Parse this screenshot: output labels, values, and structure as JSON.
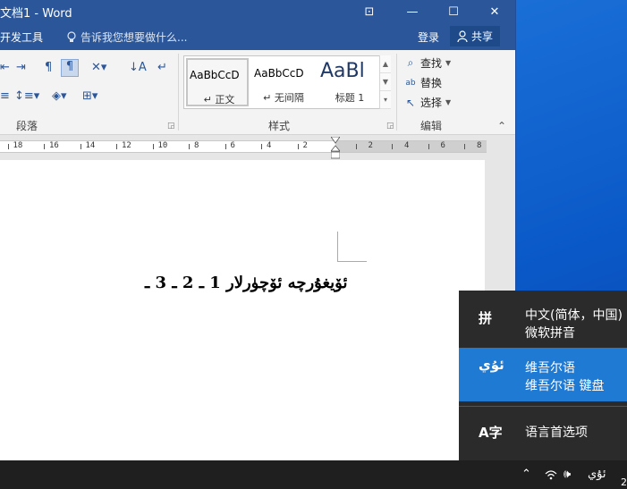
{
  "window": {
    "title": "文档1 - Word",
    "controls": {
      "ribbon_display": "⊡",
      "minimize": "—",
      "maximize": "☐",
      "close": "✕"
    }
  },
  "tabs": {
    "developer": "开发工具",
    "tell_me": "告诉我您想要做什么...",
    "sign_in": "登录",
    "share": "共享"
  },
  "ribbon": {
    "paragraph_label": "段落",
    "styles_label": "样式",
    "editing_label": "编辑",
    "styles": [
      {
        "preview": "AaBbCcD",
        "name": "↵ 正文"
      },
      {
        "preview": "AaBbCcD",
        "name": "↵ 无间隔"
      },
      {
        "preview": "AaBl",
        "name": "标题 1"
      }
    ],
    "find": "查找",
    "replace": "替换",
    "select": "选择"
  },
  "ruler": {
    "left_numbers": [
      "18",
      "16",
      "14",
      "12",
      "10",
      "8",
      "6",
      "4",
      "2"
    ],
    "right_numbers": [
      "2",
      "4",
      "6",
      "8"
    ]
  },
  "document": {
    "heading": "ئۆيغۇرچە ئۆچۈرلار 1 ـ 2 ـ 3 ـ"
  },
  "ime_flyout": {
    "items": [
      {
        "icon": "拼",
        "line1": "中文(简体，中国)",
        "line2": "微软拼音",
        "selected": false
      },
      {
        "icon": "ئۇي",
        "line1": "维吾尔语",
        "line2": "维吾尔语 键盘",
        "selected": true
      },
      {
        "icon": "A字",
        "line1": "语言首选项",
        "line2": "",
        "selected": false
      }
    ]
  },
  "taskbar": {
    "input_indicator": "ئۇي",
    "clock_fragment": "2"
  },
  "colors": {
    "word_blue": "#2b579a",
    "flyout_bg": "#2b2b2b",
    "flyout_selected": "#1f7ad4",
    "taskbar": "#1f1f1f"
  }
}
